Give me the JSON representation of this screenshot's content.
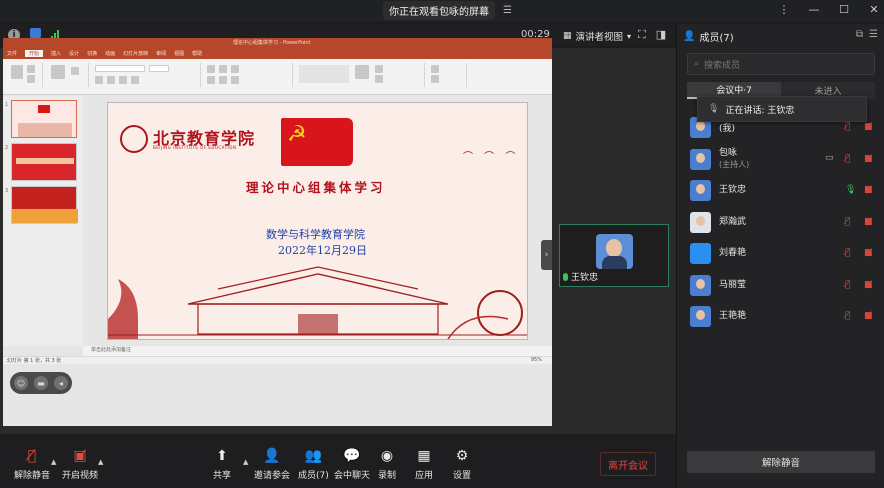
{
  "window": {
    "banner_text": "你正在观看包咏的屏幕",
    "controls": [
      "⋮",
      "—",
      "☐",
      "✕"
    ]
  },
  "meeting": {
    "timer": "00:29",
    "view_mode": "演讲者视图",
    "view_caret": "▾"
  },
  "presentation": {
    "title_bar": "理论中心组集体学习 - PowerPoint",
    "tabs": [
      "文件",
      "开始",
      "插入",
      "设计",
      "切换",
      "动画",
      "幻灯片放映",
      "审阅",
      "视图",
      "帮助"
    ],
    "active_tab": "开始",
    "thumb_numbers": [
      "1",
      "2",
      "3"
    ],
    "slide": {
      "logo_text": "北京教育学院",
      "logo_sub": "BEIJING INSTITUTE OF EDUCATION",
      "heading": "理论中心组集体学习",
      "college": "数学与科学教育学院",
      "date": "2022年12月29日"
    },
    "notes_placeholder": "单击此处添加备注",
    "status_left": "幻灯片 第 1 张，共 3 张",
    "zoom": "95%"
  },
  "video": {
    "speaker_name": "王钦忠"
  },
  "members_panel": {
    "title": "成员(7)",
    "search_placeholder": "搜索成员",
    "tab_in_meeting": "会议中·7",
    "tab_not_joined": "未进入",
    "speaking_tooltip": "正在讲话: 王钦忠",
    "members": [
      {
        "name": "(我)",
        "sub": "",
        "mic": "muted",
        "cam": "off",
        "avatar": "photo"
      },
      {
        "name": "包咏",
        "sub": "(主持人)",
        "mic": "muted",
        "cam": "off",
        "avatar": "photo",
        "sharing": true
      },
      {
        "name": "王钦忠",
        "sub": "",
        "mic": "on",
        "cam": "off",
        "avatar": "photo"
      },
      {
        "name": "郑瀚武",
        "sub": "",
        "mic": "muted",
        "cam": "off",
        "avatar": "white"
      },
      {
        "name": "刘春艳",
        "sub": "",
        "mic": "muted",
        "cam": "off",
        "avatar": "blue"
      },
      {
        "name": "马丽莹",
        "sub": "",
        "mic": "muted",
        "cam": "off",
        "avatar": "photo"
      },
      {
        "name": "王艳艳",
        "sub": "",
        "mic": "muted",
        "cam": "off",
        "avatar": "photo"
      }
    ],
    "unmute_all": "解除静音"
  },
  "toolbar": {
    "unmute": "解除静音",
    "start_video": "开启视频",
    "share": "共享",
    "invite": "邀请参会",
    "members": "成员(7)",
    "chat": "会中聊天",
    "record": "录制",
    "apps": "应用",
    "settings": "设置",
    "leave": "离开会议"
  },
  "colors": {
    "accent_red": "#e04b3f",
    "ppt_red": "#b7472a",
    "mic_green": "#34c759"
  }
}
